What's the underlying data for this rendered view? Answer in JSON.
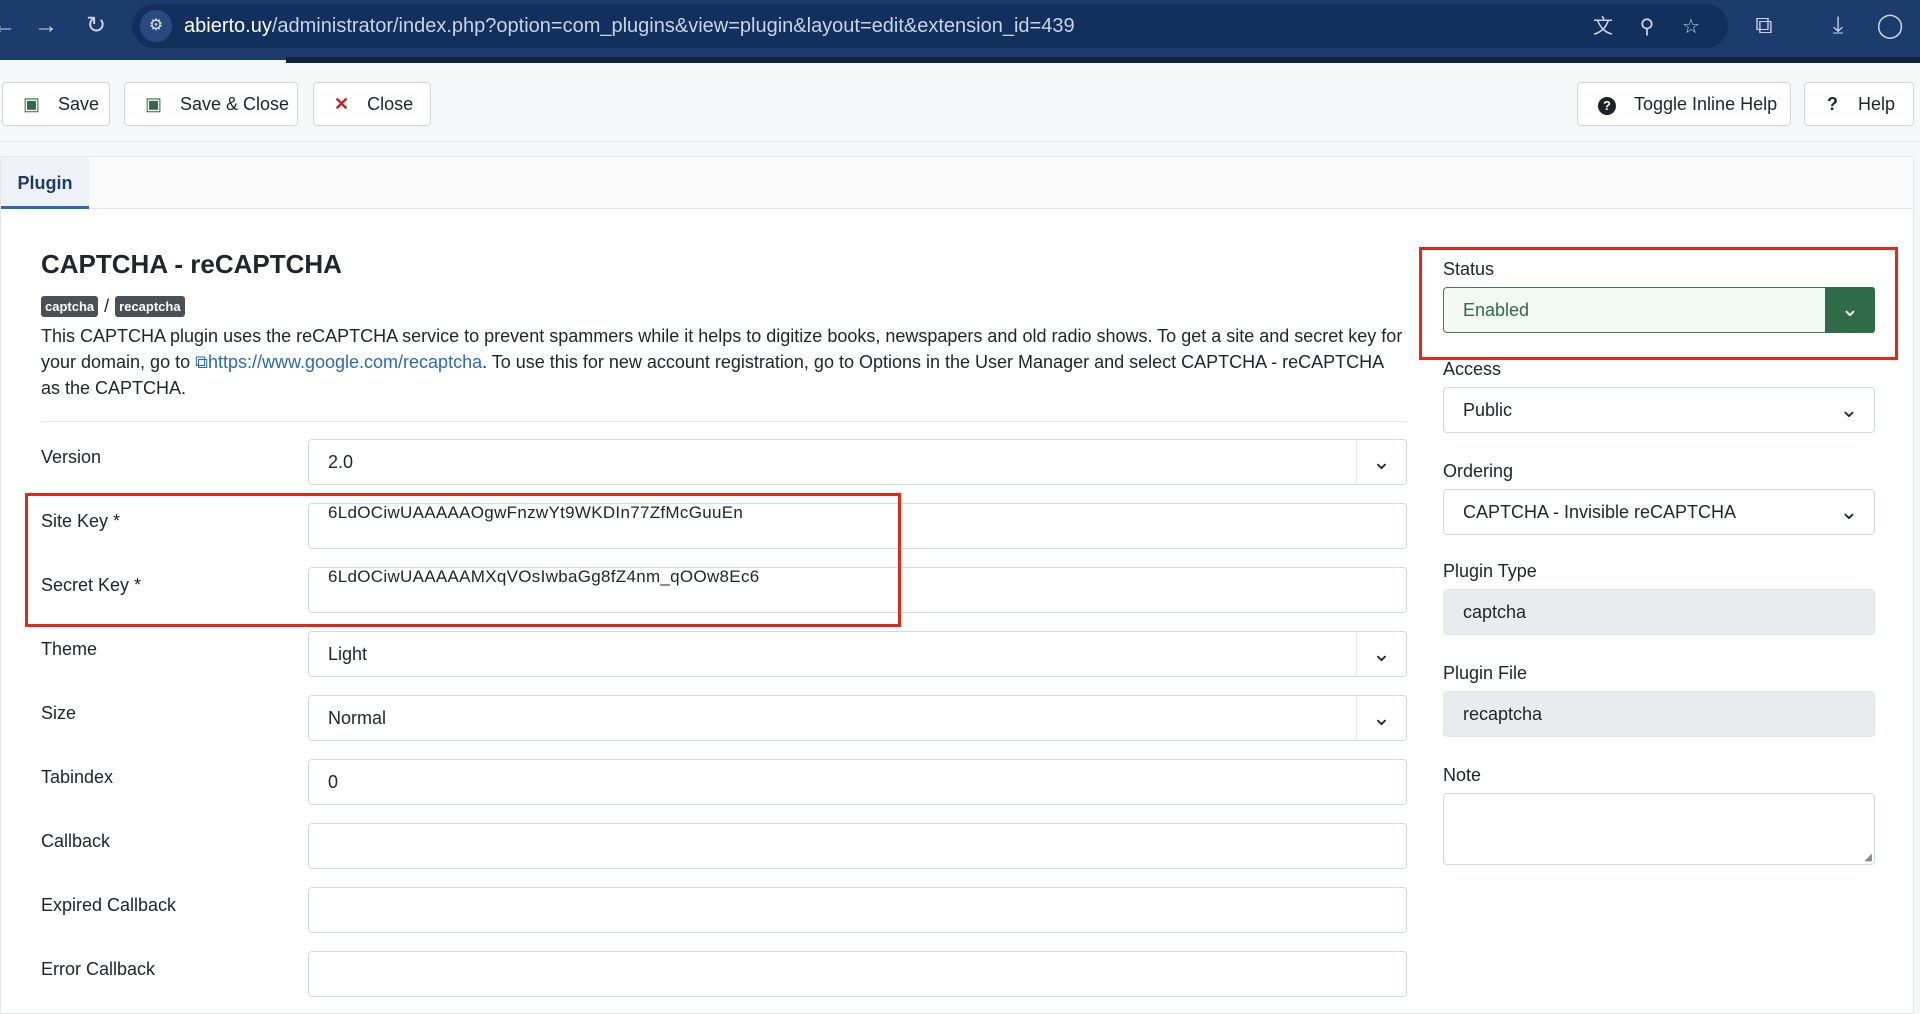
{
  "browser": {
    "url_domain": "abierto.uy",
    "url_path": "/administrator/index.php?option=com_plugins&view=plugin&layout=edit&extension_id=439"
  },
  "toolbar": {
    "save_label": "Save",
    "save_close_label": "Save & Close",
    "close_label": "Close",
    "inline_help_label": "Toggle Inline Help",
    "help_label": "Help"
  },
  "tabs": [
    {
      "label": "Plugin",
      "active": true
    }
  ],
  "plugin": {
    "title": "CAPTCHA - reCAPTCHA",
    "folder_badge": "captcha",
    "element_badge": "recaptcha",
    "badge_separator": "/",
    "description_1": "This CAPTCHA plugin uses the reCAPTCHA service to prevent spammers while it helps to digitize books, newspapers and old radio shows. To get a site and secret key for your domain, go to ",
    "link_text": "https://www.google.com/recaptcha",
    "description_2": ". To use this for new account registration, go to Options in the User Manager and select CAPTCHA - reCAPTCHA as the CAPTCHA."
  },
  "fields": {
    "version": {
      "label": "Version",
      "value": "2.0"
    },
    "site_key": {
      "label": "Site Key *",
      "value": "6LdOCiwUAAAAAOgwFnzwYt9WKDIn77ZfMcGuuEn"
    },
    "secret_key": {
      "label": "Secret Key *",
      "value": "6LdOCiwUAAAAAMXqVOsIwbaGg8fZ4nm_qOOw8Ec6"
    },
    "theme": {
      "label": "Theme",
      "value": "Light"
    },
    "size": {
      "label": "Size",
      "value": "Normal"
    },
    "tabindex": {
      "label": "Tabindex",
      "value": "0"
    },
    "callback": {
      "label": "Callback",
      "value": ""
    },
    "expired_callback": {
      "label": "Expired Callback",
      "value": ""
    },
    "error_callback": {
      "label": "Error Callback",
      "value": ""
    }
  },
  "sidebar": {
    "status": {
      "label": "Status",
      "value": "Enabled"
    },
    "access": {
      "label": "Access",
      "value": "Public"
    },
    "ordering": {
      "label": "Ordering",
      "value": "CAPTCHA - Invisible reCAPTCHA"
    },
    "plugin_type": {
      "label": "Plugin Type",
      "value": "captcha"
    },
    "plugin_file": {
      "label": "Plugin File",
      "value": "recaptcha"
    },
    "note": {
      "label": "Note",
      "value": ""
    }
  },
  "colors": {
    "browser_bar": "#1d3c6e",
    "status_green": "#2e6b46",
    "highlight_red": "#e1281a",
    "link_blue": "#2a69b8"
  }
}
